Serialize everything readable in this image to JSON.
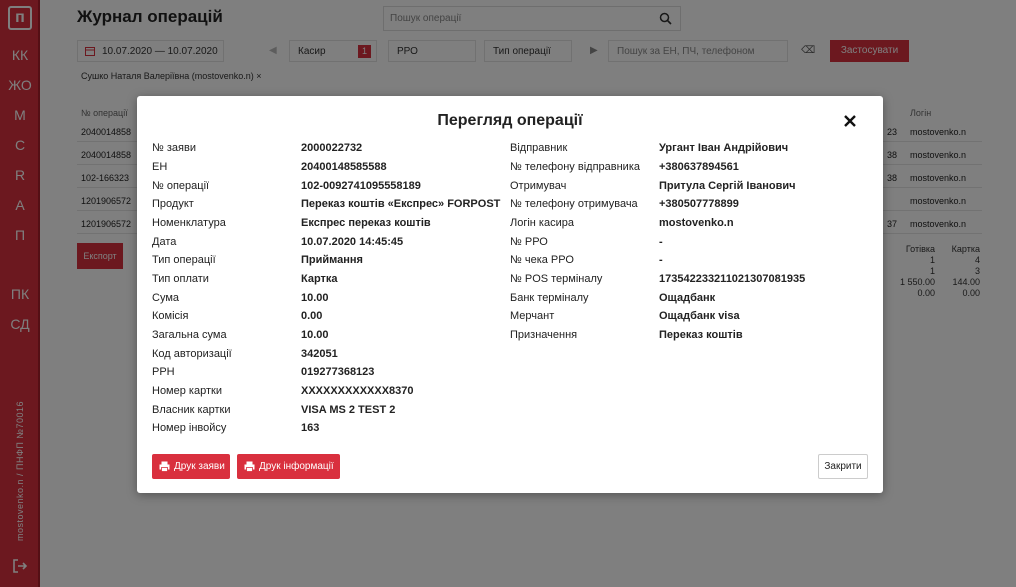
{
  "sidebar": {
    "logo": "п",
    "items": [
      "КК",
      "ЖО",
      "М",
      "С",
      "R",
      "А",
      "П",
      "ПК",
      "СД"
    ],
    "vertical_text": "mostovenko.n / ПНФП №70016"
  },
  "header": {
    "title": "Журнал операцій",
    "search_placeholder": "Пошук операції"
  },
  "filters": {
    "date_range": "10.07.2020 — 10.07.2020",
    "cashier_label": "Касир",
    "cashier_count": "1",
    "rro_label": "РРО",
    "op_type_label": "Тип операції",
    "search_placeholder": "Пошук за ЕН, ПЧ, телефоном",
    "apply_label": "Застосувати",
    "active_chip": "Сушко Наталя Валеріївна (mostovenko.n)",
    "chip_close": "×"
  },
  "table": {
    "col_op": "№ операції",
    "col_login": "Логін",
    "rows": [
      {
        "op": "2040014858",
        "tail": "23",
        "login": "mostovenko.n"
      },
      {
        "op": "2040014858",
        "tail": "38",
        "login": "mostovenko.n"
      },
      {
        "op": "102-166323",
        "tail": "38",
        "login": "mostovenko.n"
      },
      {
        "op": "1201906572",
        "tail": "",
        "login": "mostovenko.n"
      },
      {
        "op": "1201906572",
        "tail": "37",
        "login": "mostovenko.n"
      }
    ],
    "export_label": "Експорт",
    "summary": {
      "cash_label": "Готівка",
      "card_label": "Картка",
      "cash_values": [
        "1",
        "1",
        "1 550.00",
        "0.00"
      ],
      "card_values": [
        "4",
        "3",
        "144.00",
        "0.00"
      ]
    }
  },
  "modal": {
    "title": "Перегляд операції",
    "left_fields": [
      {
        "label": "№ заяви",
        "value": "2000022732"
      },
      {
        "label": "ЕН",
        "value": "20400148585588"
      },
      {
        "label": "№ операції",
        "value": "102-0092741095558189"
      },
      {
        "label": "Продукт",
        "value": "Переказ коштів «Експрес» FORPOST"
      },
      {
        "label": "Номенклатура",
        "value": "Експрес переказ коштів"
      },
      {
        "label": "Дата",
        "value": "10.07.2020 14:45:45"
      },
      {
        "label": "Тип операції",
        "value": "Приймання"
      },
      {
        "label": "Тип оплати",
        "value": "Картка"
      },
      {
        "label": "Сума",
        "value": "10.00"
      },
      {
        "label": "Комісія",
        "value": "0.00"
      },
      {
        "label": "Загальна сума",
        "value": "10.00"
      },
      {
        "label": "Код авторизації",
        "value": "342051"
      },
      {
        "label": "РРН",
        "value": "019277368123"
      },
      {
        "label": "Номер картки",
        "value": "XXXXXXXXXXXX8370"
      },
      {
        "label": "Власник картки",
        "value": "VISA MS 2 TEST 2"
      },
      {
        "label": "Номер інвойсу",
        "value": "163"
      }
    ],
    "right_fields": [
      {
        "label": "Відправник",
        "value": "Ургант Іван Андрійович"
      },
      {
        "label": "№ телефону відправника",
        "value": "+380637894561"
      },
      {
        "label": "Отримувач",
        "value": "Притула Сергій Іванович"
      },
      {
        "label": "№ телефону отримувача",
        "value": "+380507778899"
      },
      {
        "label": "Логін касира",
        "value": "mostovenko.n"
      },
      {
        "label": "№ РРО",
        "value": "-"
      },
      {
        "label": "№ чека РРО",
        "value": "-"
      },
      {
        "label": "№ POS терміналу",
        "value": "17354223321102130708​1935"
      },
      {
        "label": "Банк терміналу",
        "value": "Ощадбанк"
      },
      {
        "label": "Мерчант",
        "value": "Ощадбанк visa"
      },
      {
        "label": "Призначення",
        "value": "Переказ коштів"
      }
    ],
    "print_request_label": "Друк заяви",
    "print_info_label": "Друк інформації",
    "close_label": "Закрити",
    "close_icon": "close-icon"
  }
}
